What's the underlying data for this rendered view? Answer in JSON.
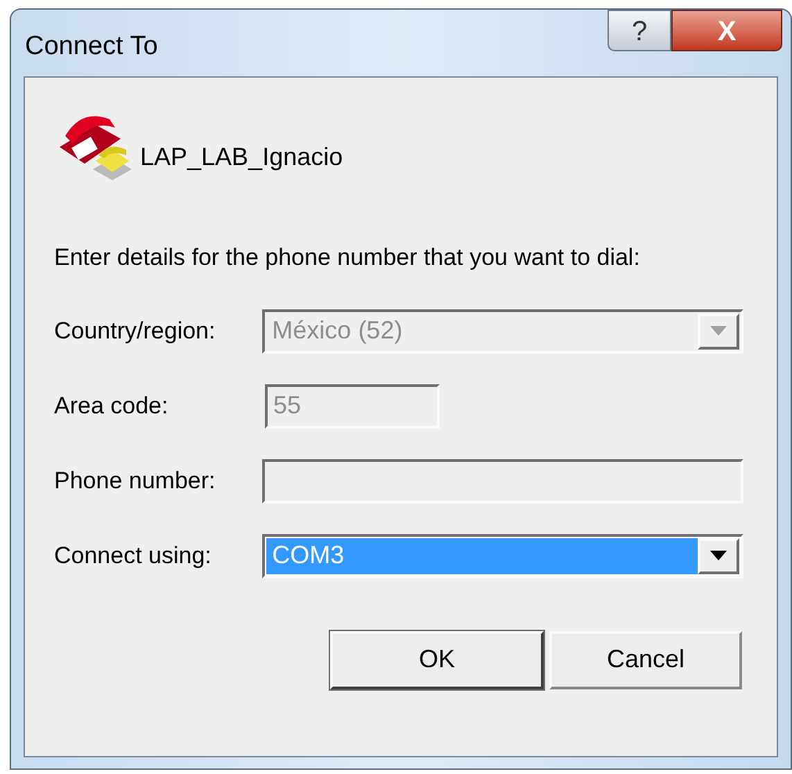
{
  "window": {
    "title": "Connect To",
    "help_button": "?",
    "close_button": "X"
  },
  "connection_name": "LAP_LAB_Ignacio",
  "instruction": "Enter details for the phone number that you want to dial:",
  "fields": [
    {
      "kind": "combo",
      "label": "Country/region:",
      "value": "México (52)",
      "disabled": true,
      "selected": false,
      "wide": true
    },
    {
      "kind": "text",
      "label": "Area code:",
      "value": "55",
      "disabled": true,
      "selected": false,
      "wide": false
    },
    {
      "kind": "text",
      "label": "Phone number:",
      "disabled": true,
      "selected": false,
      "wide": true
    },
    {
      "kind": "combo",
      "label": "Connect using:",
      "value": "COM3",
      "disabled": false,
      "selected": true,
      "wide": true
    }
  ],
  "buttons": [
    {
      "label": "OK",
      "default": true
    },
    {
      "label": "Cancel",
      "default": false
    }
  ]
}
